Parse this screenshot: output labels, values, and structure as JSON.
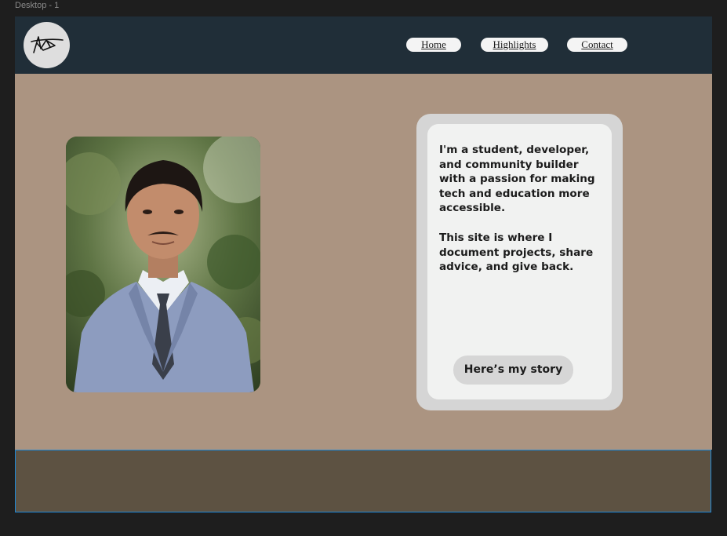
{
  "frame": {
    "label": "Desktop - 1"
  },
  "header": {
    "logo_icon": "signature-logo-icon",
    "nav": [
      {
        "label": "Home"
      },
      {
        "label": "Highlights"
      },
      {
        "label": "Contact"
      }
    ]
  },
  "hero": {
    "photo_alt": "portrait-photo",
    "intro_paragraph": "I'm a student, developer, and community builder with a passion for making tech and education more accessible.",
    "site_paragraph": "This site is where I document projects, share advice, and give back.",
    "cta_label": "Here’s my story"
  },
  "colors": {
    "header_bg": "#202e38",
    "body_bg": "#ab9481",
    "footer_bg": "#5d5242",
    "selection": "#1d88d8"
  }
}
